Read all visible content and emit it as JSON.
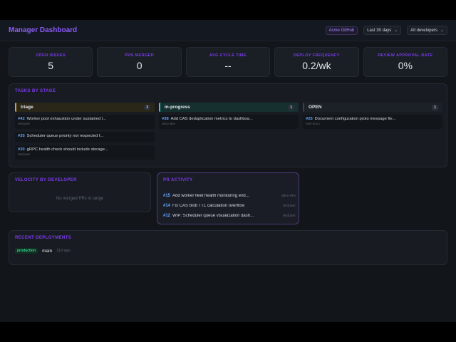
{
  "header": {
    "title": "Manager Dashboard",
    "org": "Acme GitHub",
    "range": "Last 30 days",
    "developer_filter": "All developers"
  },
  "stats": [
    {
      "label": "OPEN ISSUES",
      "value": "5"
    },
    {
      "label": "PRS MERGED",
      "value": "0"
    },
    {
      "label": "AVG CYCLE TIME",
      "value": "--"
    },
    {
      "label": "DEPLOY FREQUENCY",
      "value": "0.2/wk"
    },
    {
      "label": "REVIEW APPROVAL RATE",
      "value": "0%"
    }
  ],
  "tasks": {
    "title": "TASKS BY STAGE",
    "columns": [
      {
        "name": "triage",
        "count": "3",
        "accent": "#caa34a",
        "items": [
          {
            "num": "#42",
            "title": "Worker pool exhaustion under sustained l...",
            "author": "testuser"
          },
          {
            "num": "#35",
            "title": "Scheduler queue priority not respected f...",
            "author": ""
          },
          {
            "num": "#30",
            "title": "gRPC health check should include storage...",
            "author": "testuser"
          }
        ]
      },
      {
        "name": "in-progress",
        "count": "1",
        "accent": "#2dd4bf",
        "items": [
          {
            "num": "#38",
            "title": "Add CAS deduplication metrics to dashboa...",
            "author": "alice-dev"
          }
        ]
      },
      {
        "name": "OPEN",
        "count": "1",
        "accent": "#3a414b",
        "items": [
          {
            "num": "#25",
            "title": "Document configuration proto message fie...",
            "author": "bob-docs"
          }
        ]
      }
    ]
  },
  "velocity": {
    "title": "VELOCITY BY DEVELOPER",
    "empty": "No merged PRs in range"
  },
  "pr_activity": {
    "title": "PR ACTIVITY",
    "items": [
      {
        "num": "#15",
        "title": "Add worker fleet health monitoring end...",
        "author": "alice-dev"
      },
      {
        "num": "#14",
        "title": "Fix CAS blob TTL calculation overflow",
        "author": "testuser"
      },
      {
        "num": "#12",
        "title": "WIP: Scheduler queue visualization dash...",
        "author": "testuser"
      }
    ]
  },
  "deployments": {
    "title": "RECENT DEPLOYMENTS",
    "items": [
      {
        "env": "production",
        "branch": "main",
        "ago": "11d ago"
      }
    ]
  }
}
